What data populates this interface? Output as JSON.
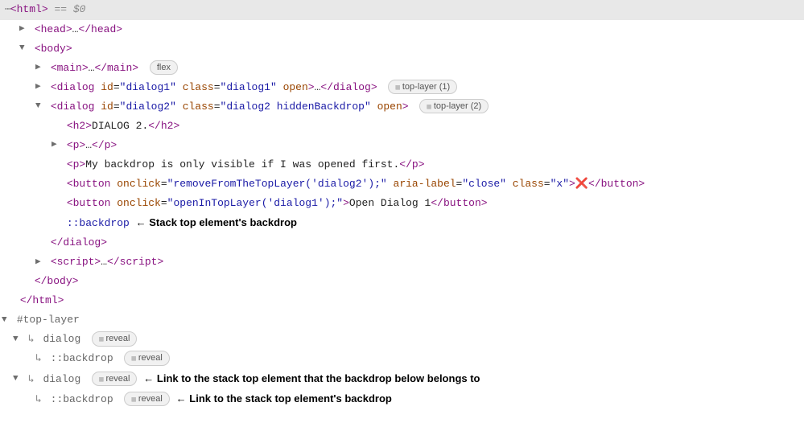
{
  "topline": {
    "tag_open": "<html>",
    "equals": " == ",
    "dollar": "$0"
  },
  "tree": {
    "head": {
      "open": "<head>",
      "ellipsis": "…",
      "close": "</head>"
    },
    "body_open": "<body>",
    "main": {
      "open": "<main>",
      "ellipsis": "…",
      "close": "</main>",
      "badge": "flex"
    },
    "dialog1": {
      "lt": "<",
      "name": "dialog",
      "attr_id": "id",
      "val_id": "\"dialog1\"",
      "attr_class": "class",
      "val_class": "\"dialog1\"",
      "attr_open": "open",
      "gt": ">",
      "ellipsis": "…",
      "close": "</dialog>",
      "badge": "top-layer (1)"
    },
    "dialog2": {
      "lt": "<",
      "name": "dialog",
      "attr_id": "id",
      "val_id": "\"dialog2\"",
      "attr_class": "class",
      "val_class": "\"dialog2 hiddenBackdrop\"",
      "attr_open": "open",
      "gt": ">",
      "badge": "top-layer (2)",
      "h2": {
        "open": "<h2>",
        "text": "DIALOG 2.",
        "close": "</h2>"
      },
      "p1": {
        "open": "<p>",
        "ellipsis": "…",
        "close": "</p>"
      },
      "p2": {
        "open": "<p>",
        "text": "My backdrop is only visible if I was opened first.",
        "close": "</p>"
      },
      "btn1": {
        "lt": "<",
        "name": "button",
        "attr_onclick": "onclick",
        "val_onclick": "\"removeFromTheTopLayer('dialog2');\"",
        "attr_aria": "aria-label",
        "val_aria": "\"close\"",
        "attr_class": "class",
        "val_class": "\"x\"",
        "gt": ">",
        "text": "❌",
        "close": "</button>"
      },
      "btn2": {
        "lt": "<",
        "name": "button",
        "attr_onclick": "onclick",
        "val_onclick": "\"openInTopLayer('dialog1');\"",
        "gt": ">",
        "text": "Open Dialog 1",
        "close": "</button>"
      },
      "backdrop": {
        "pseudo": "::backdrop",
        "anno": "← Stack top element's backdrop"
      },
      "close": "</dialog>"
    },
    "script": {
      "open": "<script>",
      "ellipsis": "…",
      "close": "</script>"
    },
    "body_close": "</body>",
    "html_close": "</html>"
  },
  "toplayer": {
    "header": "#top-layer",
    "d1": {
      "hook": "↳",
      "name": "dialog",
      "badge": "reveal"
    },
    "d1b": {
      "hook": "↳",
      "name": "::backdrop",
      "badge": "reveal"
    },
    "d2": {
      "hook": "↳",
      "name": "dialog",
      "badge": "reveal",
      "anno": "← Link to the stack top element that the backdrop below belongs to"
    },
    "d2b": {
      "hook": "↳",
      "name": "::backdrop",
      "badge": "reveal",
      "anno": "← Link to the stack top element's backdrop"
    }
  }
}
